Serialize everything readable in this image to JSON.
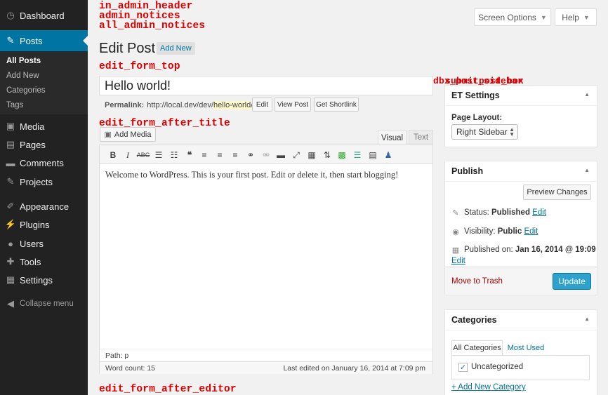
{
  "sidebar": {
    "items": [
      {
        "label": "Dashboard",
        "icon": "dashboard-icon"
      },
      {
        "label": "Posts",
        "icon": "pin-icon"
      },
      {
        "label": "Media",
        "icon": "media-icon"
      },
      {
        "label": "Pages",
        "icon": "pages-icon"
      },
      {
        "label": "Comments",
        "icon": "comments-icon"
      },
      {
        "label": "Projects",
        "icon": "pin-icon"
      },
      {
        "label": "Appearance",
        "icon": "brush-icon"
      },
      {
        "label": "Plugins",
        "icon": "plugin-icon"
      },
      {
        "label": "Users",
        "icon": "users-icon"
      },
      {
        "label": "Tools",
        "icon": "wrench-icon"
      },
      {
        "label": "Settings",
        "icon": "settings-icon"
      }
    ],
    "submenu": [
      "All Posts",
      "Add New",
      "Categories",
      "Tags"
    ],
    "collapse": "Collapse menu"
  },
  "hooks": {
    "header_1": "in_admin_header",
    "header_2": "admin_notices",
    "header_3": "all_admin_notices",
    "form_top": "edit_form_top",
    "after_title": "edit_form_after_title",
    "after_editor": "edit_form_after_editor",
    "sidebar_a": "dbx_post_sidebar",
    "sidebar_b": "submitpost_box"
  },
  "screen": {
    "options": "Screen Options",
    "help": "Help"
  },
  "header": {
    "title": "Edit Post",
    "add_new": "Add New"
  },
  "post": {
    "title": "Hello world!",
    "permalink_label": "Permalink:",
    "permalink_base": "http://local.dev/dev/",
    "permalink_slug": "hello-world",
    "permalink_end": "/",
    "edit_btn": "Edit",
    "view_btn": "View Post",
    "shortlink_btn": "Get Shortlink"
  },
  "editor": {
    "add_media": "Add Media",
    "tab_visual": "Visual",
    "tab_text": "Text",
    "content": "Welcome to WordPress. This is your first post. Edit or delete it, then start blogging!",
    "path": "Path: p",
    "word_count": "Word count: 15",
    "last_edited": "Last edited on January 16, 2014 at 7:09 pm"
  },
  "et_settings": {
    "title": "ET Settings",
    "layout_label": "Page Layout:",
    "layout_value": "Right Sidebar"
  },
  "publish": {
    "title": "Publish",
    "preview": "Preview Changes",
    "status_label": "Status:",
    "status_value": "Published",
    "visibility_label": "Visibility:",
    "visibility_value": "Public",
    "published_label": "Published on:",
    "published_value": "Jan 16, 2014 @ 19:09",
    "edit": "Edit",
    "trash": "Move to Trash",
    "update": "Update"
  },
  "categories": {
    "title": "Categories",
    "tab_all": "All Categories",
    "tab_used": "Most Used",
    "item": "Uncategorized",
    "add_new": "+ Add New Category"
  },
  "colors": {
    "accent": "#0074a2",
    "update": "#2ea2cc",
    "hook": "#dd0000"
  }
}
